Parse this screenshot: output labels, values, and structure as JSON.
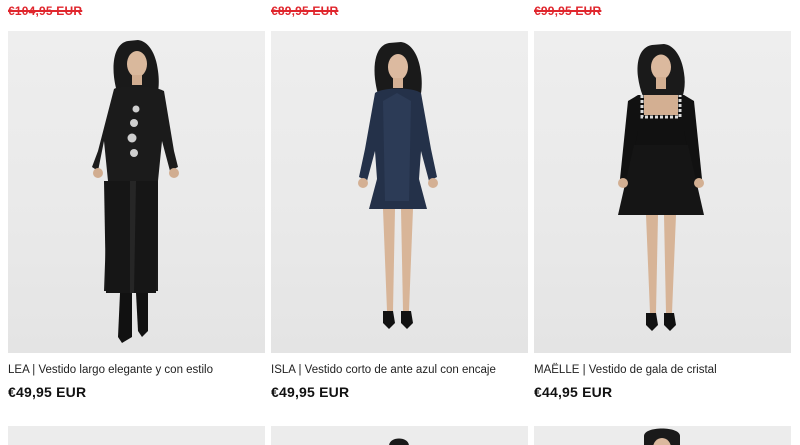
{
  "products": [
    {
      "old_price": "€104,95 EUR",
      "title": "LEA | Vestido largo elegante y con estilo",
      "price": "€49,95 EUR"
    },
    {
      "old_price": "€89,95 EUR",
      "title": "ISLA | Vestido corto de ante azul con encaje",
      "price": "€49,95 EUR"
    },
    {
      "old_price": "€99,95 EUR",
      "title": "MAËLLE | Vestido de gala de cristal",
      "price": "€44,95 EUR"
    }
  ],
  "colors": {
    "sale_red": "#e0262d",
    "text": "#111111",
    "image_background": "#ececec"
  }
}
